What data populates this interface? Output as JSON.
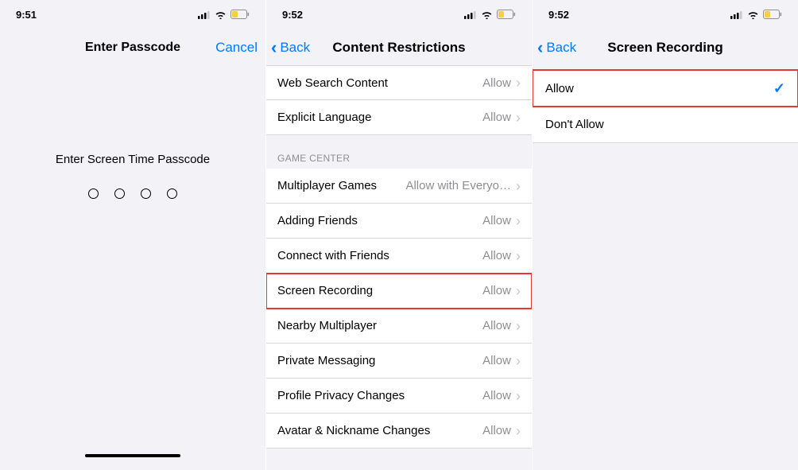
{
  "status": {
    "time1": "9:51",
    "time2": "9:52",
    "time3": "9:52"
  },
  "phone1": {
    "title": "Enter Passcode",
    "cancel": "Cancel",
    "prompt": "Enter Screen Time Passcode"
  },
  "phone2": {
    "back": "Back",
    "title": "Content Restrictions",
    "topRows": [
      {
        "label": "Web Search Content",
        "value": "Allow"
      },
      {
        "label": "Explicit Language",
        "value": "Allow"
      }
    ],
    "gcHeader": "GAME CENTER",
    "gcRows": [
      {
        "label": "Multiplayer Games",
        "value": "Allow with Everyo…",
        "highlight": false
      },
      {
        "label": "Adding Friends",
        "value": "Allow",
        "highlight": false
      },
      {
        "label": "Connect with Friends",
        "value": "Allow",
        "highlight": false
      },
      {
        "label": "Screen Recording",
        "value": "Allow",
        "highlight": true
      },
      {
        "label": "Nearby Multiplayer",
        "value": "Allow",
        "highlight": false
      },
      {
        "label": "Private Messaging",
        "value": "Allow",
        "highlight": false
      },
      {
        "label": "Profile Privacy Changes",
        "value": "Allow",
        "highlight": false
      },
      {
        "label": "Avatar & Nickname Changes",
        "value": "Allow",
        "highlight": false
      }
    ]
  },
  "phone3": {
    "back": "Back",
    "title": "Screen Recording",
    "rows": [
      {
        "label": "Allow",
        "checked": true,
        "highlight": true
      },
      {
        "label": "Don't Allow",
        "checked": false,
        "highlight": false
      }
    ]
  },
  "colors": {
    "accent": "#007aff",
    "highlight": "#e53935",
    "secondary": "#8e8e93"
  }
}
